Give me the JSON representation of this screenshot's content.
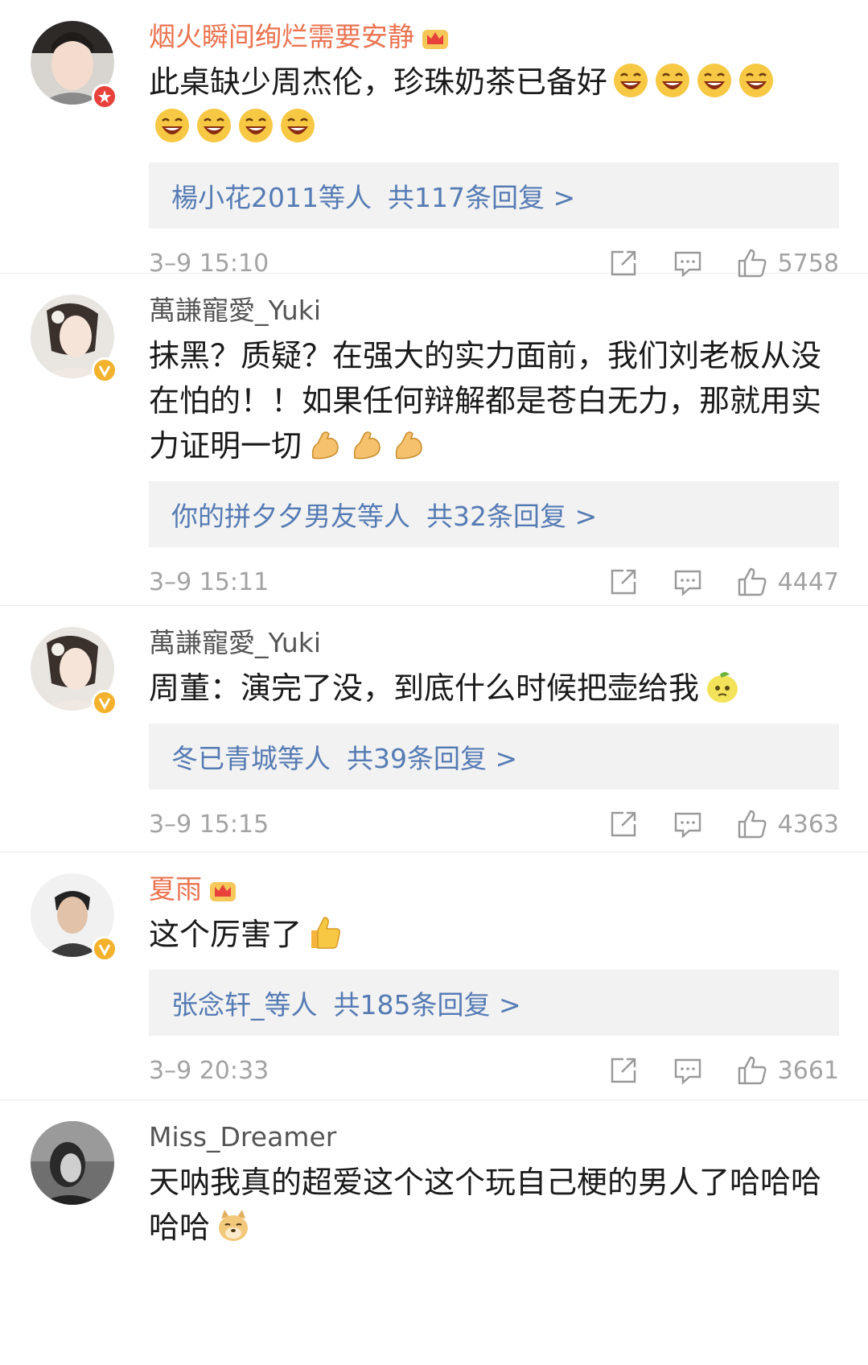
{
  "comments": [
    {
      "user": "烟火瞬间绚烂需要安静",
      "vip": true,
      "badge": "red",
      "text": "此桌缺少周杰伦，珍珠奶茶已备好",
      "emoji": "laughing-emoji",
      "emoji_count": 8,
      "reply_who": "楊小花2011等人",
      "reply_count": "共117条回复 >",
      "time": "3–9 15:10",
      "likes": "5758"
    },
    {
      "user": "萬謙寵愛_Yuki",
      "vip": false,
      "badge": "gold",
      "text": "抹黑？质疑？在强大的实力面前，我们刘老板从没在怕的！！如果任何辩解都是苍白无力，那就用实力证明一切",
      "emoji": "muscle-emoji",
      "emoji_count": 3,
      "reply_who": "你的拼夕夕男友等人",
      "reply_count": "共32条回复 >",
      "time": "3–9 15:11",
      "likes": "4447"
    },
    {
      "user": "萬謙寵愛_Yuki",
      "vip": false,
      "badge": "gold",
      "text": "周董：演完了没，到底什么时候把壶给我",
      "emoji": "lemon-emoji",
      "emoji_count": 1,
      "reply_who": "冬已青城等人",
      "reply_count": "共39条回复 >",
      "time": "3–9 15:15",
      "likes": "4363"
    },
    {
      "user": "夏雨",
      "vip": true,
      "badge": "gold",
      "text": "这个厉害了",
      "emoji": "thumbs-up-emoji",
      "emoji_count": 1,
      "reply_who": "张念轩_等人",
      "reply_count": "共185条回复 >",
      "time": "3–9 20:33",
      "likes": "3661"
    },
    {
      "user": "Miss_Dreamer",
      "vip": false,
      "badge": "none",
      "text": "天呐我真的超爱这个这个玩自己梗的男人了哈哈哈哈哈",
      "emoji": "doge-emoji",
      "emoji_count": 1
    }
  ],
  "colors": {
    "vip_name": "#eb7350",
    "link": "#557bb4",
    "muted": "#a3a3a3",
    "reply_bg": "#f2f2f2"
  }
}
